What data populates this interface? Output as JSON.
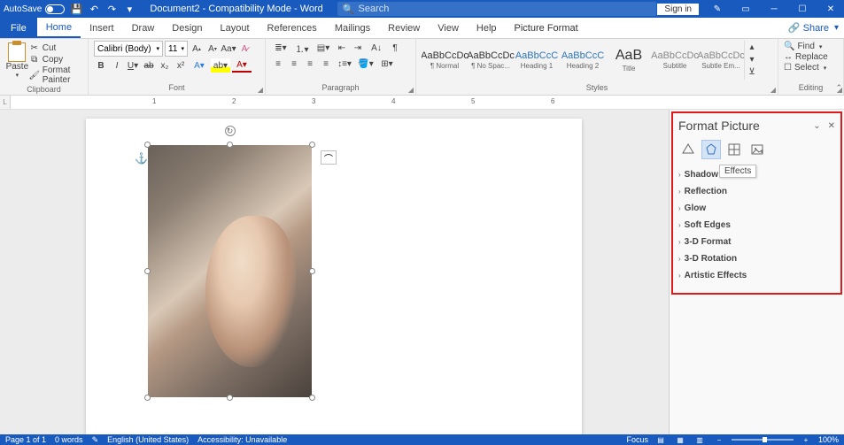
{
  "titlebar": {
    "autosave": "AutoSave",
    "doc_title": "Document2 - Compatibility Mode - Word",
    "search_placeholder": "Search",
    "signin": "Sign in"
  },
  "tabs": {
    "file": "File",
    "home": "Home",
    "insert": "Insert",
    "draw": "Draw",
    "design": "Design",
    "layout": "Layout",
    "references": "References",
    "mailings": "Mailings",
    "review": "Review",
    "view": "View",
    "help": "Help",
    "picture_format": "Picture Format",
    "share": "Share"
  },
  "ribbon": {
    "clipboard": {
      "paste": "Paste",
      "cut": "Cut",
      "copy": "Copy",
      "format_painter": "Format Painter",
      "label": "Clipboard"
    },
    "font": {
      "name": "Calibri (Body)",
      "size": "11",
      "label": "Font"
    },
    "paragraph": {
      "label": "Paragraph"
    },
    "styles": {
      "items": [
        {
          "preview": "AaBbCcDc",
          "name": "¶ Normal"
        },
        {
          "preview": "AaBbCcDc",
          "name": "¶ No Spac..."
        },
        {
          "preview": "AaBbCcC",
          "name": "Heading 1"
        },
        {
          "preview": "AaBbCcC",
          "name": "Heading 2"
        },
        {
          "preview": "AaB",
          "name": "Title"
        },
        {
          "preview": "AaBbCcDc",
          "name": "Subtitle"
        },
        {
          "preview": "AaBbCcDc",
          "name": "Subtle Em..."
        }
      ],
      "label": "Styles"
    },
    "editing": {
      "find": "Find",
      "replace": "Replace",
      "select": "Select",
      "label": "Editing"
    }
  },
  "ruler": {
    "marks": [
      "1",
      "2",
      "3",
      "4",
      "5",
      "6"
    ]
  },
  "pane": {
    "title": "Format Picture",
    "tooltip": "Effects",
    "sections": {
      "shadow": "Shadow",
      "reflection": "Reflection",
      "glow": "Glow",
      "soft_edges": "Soft Edges",
      "threed_format": "3-D Format",
      "threed_rotation": "3-D Rotation",
      "artistic": "Artistic Effects"
    }
  },
  "status": {
    "page": "Page 1 of 1",
    "words": "0 words",
    "lang": "English (United States)",
    "accessibility": "Accessibility: Unavailable",
    "focus": "Focus",
    "zoom": "100%"
  }
}
